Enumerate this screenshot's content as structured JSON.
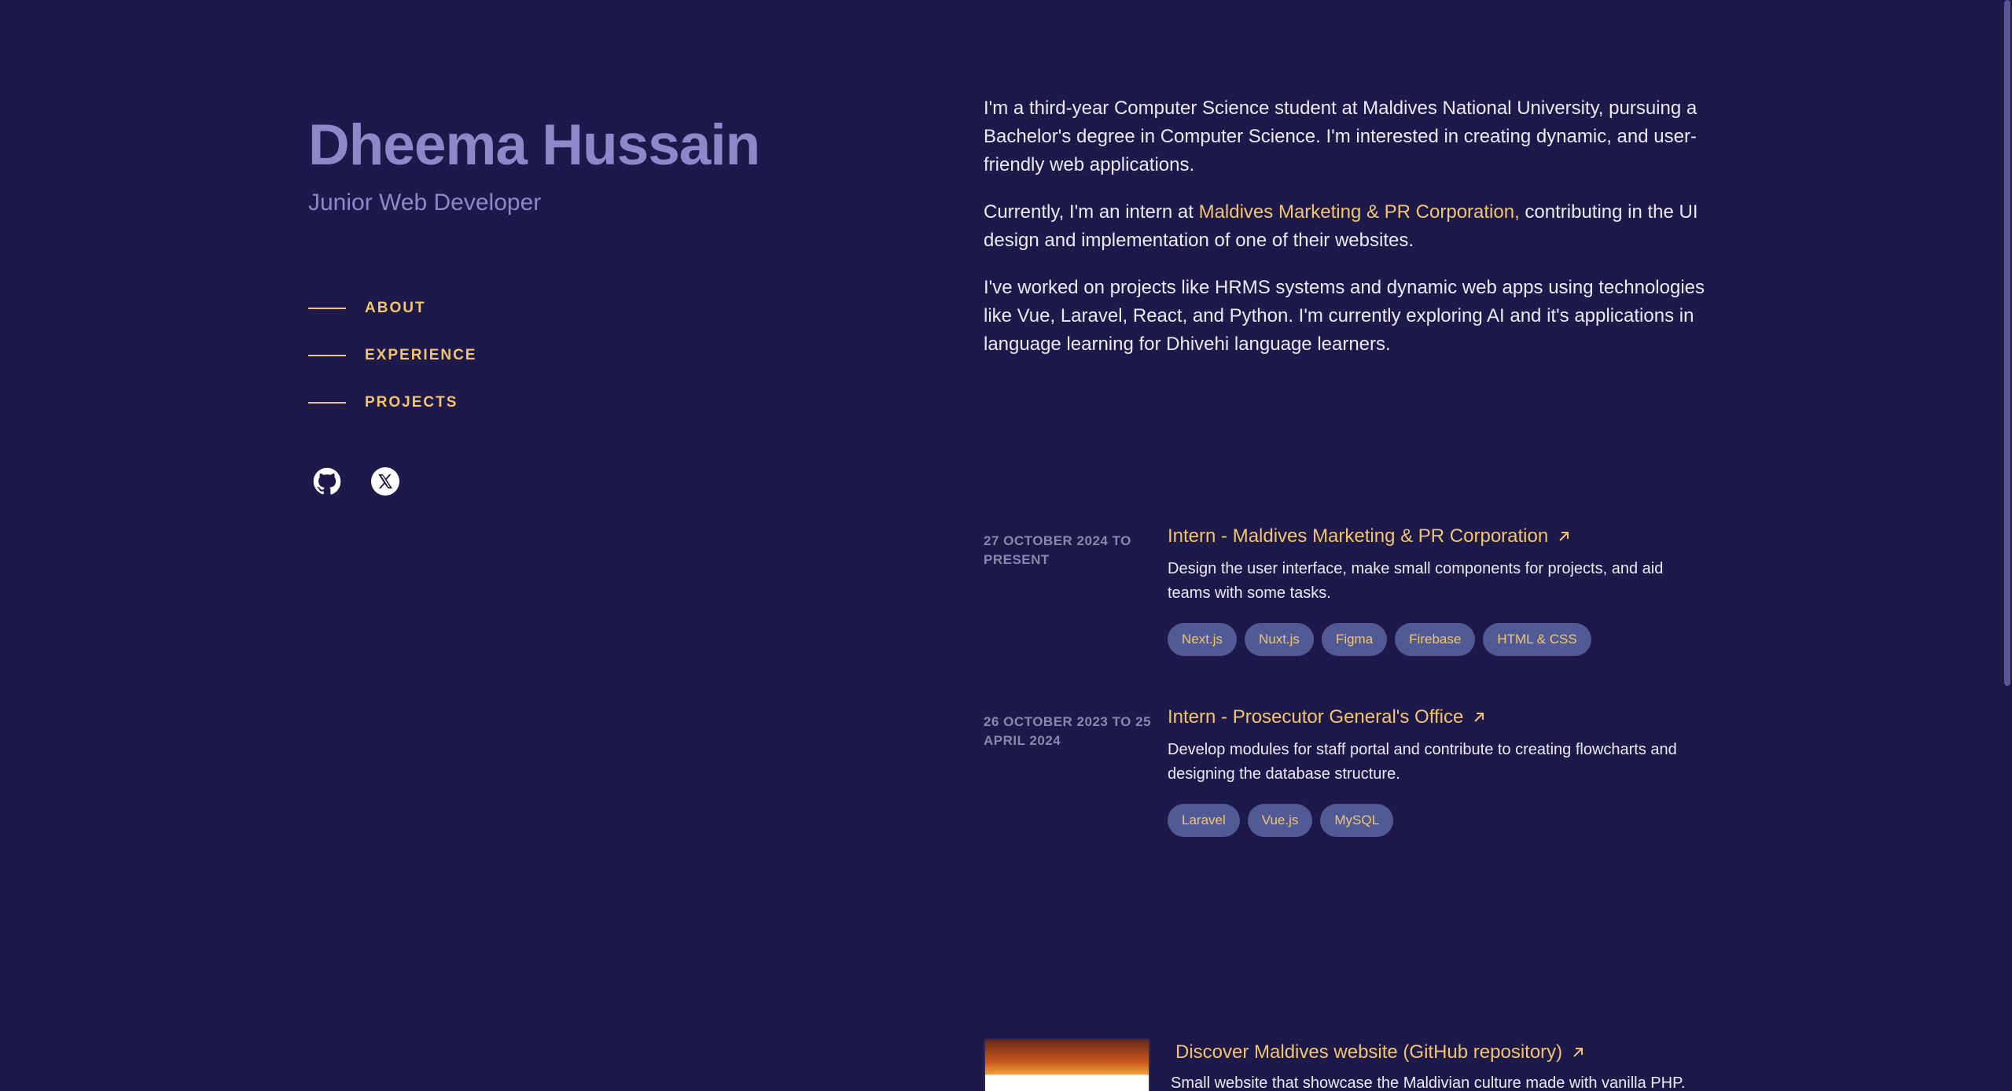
{
  "profile": {
    "name": "Dheema Hussain",
    "role": "Junior Web Developer"
  },
  "nav": [
    {
      "label": "ABOUT"
    },
    {
      "label": "EXPERIENCE"
    },
    {
      "label": "PROJECTS"
    }
  ],
  "socials": [
    {
      "icon": "github-icon"
    },
    {
      "icon": "x-twitter-icon"
    }
  ],
  "about": {
    "p1": "I'm a third-year Computer Science student at Maldives National University, pursuing a Bachelor's degree in Computer Science. I'm interested in creating dynamic, and user-friendly web applications.",
    "p2_before": "Currently, I'm an intern at ",
    "p2_link": "Maldives Marketing & PR Corporation,",
    "p2_after": " contributing in the UI design and implementation of one of their websites.",
    "p3": "I've worked on projects like HRMS systems and dynamic web apps using technologies like Vue, Laravel, React, and Python. I'm currently exploring AI and it's applications in language learning for Dhivehi language learners."
  },
  "experience": [
    {
      "date": "27 OCTOBER 2024 TO PRESENT",
      "title": "Intern - Maldives Marketing & PR Corporation",
      "desc": "Design the user interface, make small components for projects, and aid teams with some tasks.",
      "tags": [
        "Next.js",
        "Nuxt.js",
        "Figma",
        "Firebase",
        "HTML & CSS"
      ]
    },
    {
      "date": "26 OCTOBER 2023 TO 25 APRIL 2024",
      "title": "Intern - Prosecutor General's Office",
      "desc": "Develop modules for staff portal and contribute to creating flowcharts and designing the database structure.",
      "tags": [
        "Laravel",
        "Vue.js",
        "MySQL"
      ]
    }
  ],
  "project": {
    "title": "Discover Maldives website (GitHub repository)",
    "desc": "Small website that showcase the Maldivian culture made with vanilla PHP."
  },
  "colors": {
    "background": "#1d1a4b",
    "accent": "#f2c46b",
    "name": "#8d88c9",
    "tag_bg": "#525a96"
  }
}
